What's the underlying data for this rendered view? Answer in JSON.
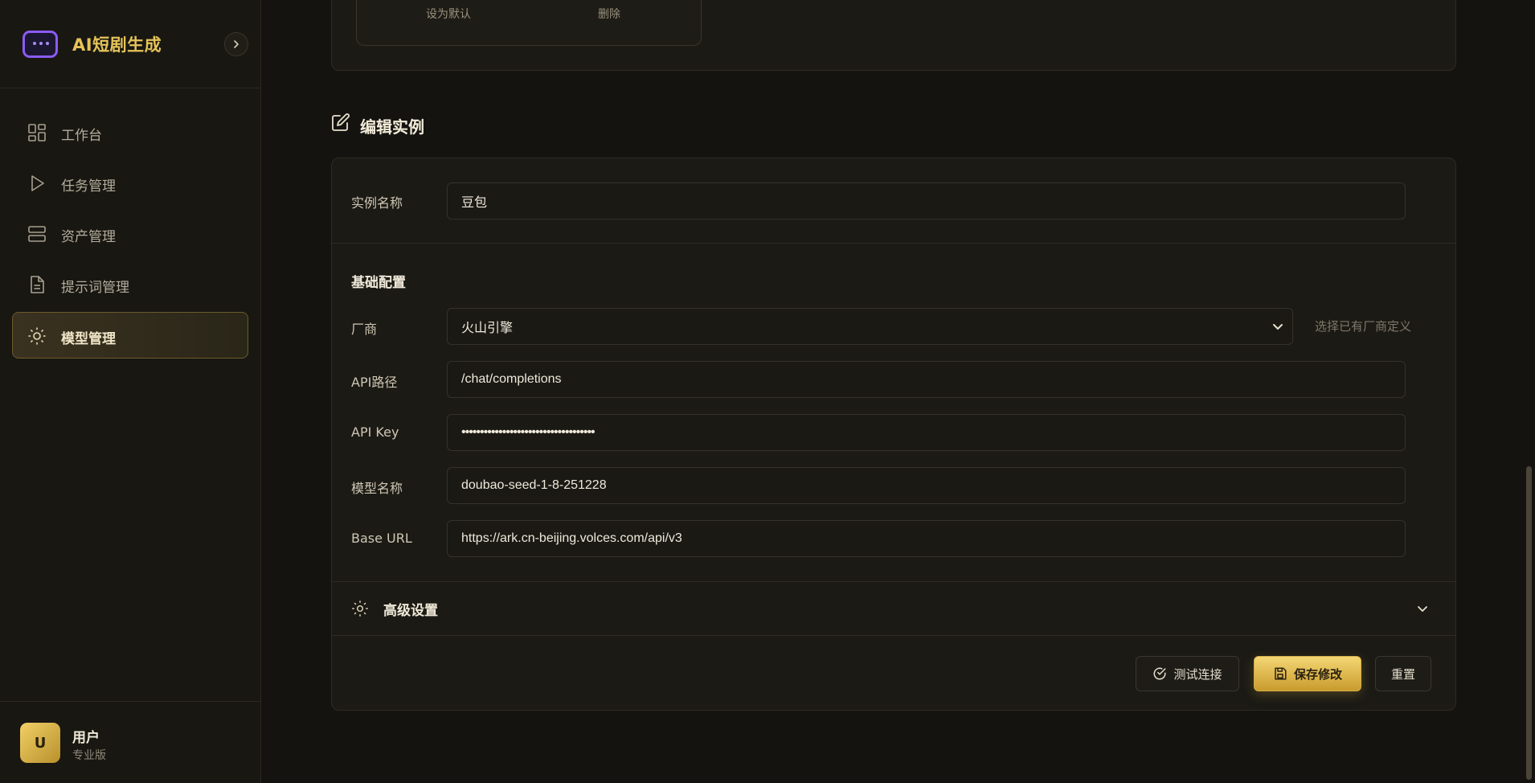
{
  "brand": {
    "title": "AI短剧生成",
    "logo_icon": "window-dots-icon",
    "collapse_icon": "chevron-right-icon"
  },
  "nav": {
    "items": [
      {
        "label": "工作台",
        "icon": "grid-icon",
        "active": false
      },
      {
        "label": "任务管理",
        "icon": "play-icon",
        "active": false
      },
      {
        "label": "资产管理",
        "icon": "server-icon",
        "active": false
      },
      {
        "label": "提示词管理",
        "icon": "file-text-icon",
        "active": false
      },
      {
        "label": "模型管理",
        "icon": "sun-icon",
        "active": true
      }
    ]
  },
  "user": {
    "avatar_letter": "U",
    "name": "用户",
    "plan": "专业版"
  },
  "top_card": {
    "set_default": "设为默认",
    "delete": "删除"
  },
  "edit": {
    "section_title": "编辑实例",
    "instance_name_label": "实例名称",
    "instance_name_value": "豆包",
    "basic_config": "基础配置",
    "vendor_label": "厂商",
    "vendor_value": "火山引擎",
    "vendor_hint": "选择已有厂商定义",
    "api_path_label": "API路径",
    "api_path_value": "/chat/completions",
    "api_key_label": "API Key",
    "api_key_value": "••••••••••••••••••••••••••••••••••••",
    "model_name_label": "模型名称",
    "model_name_value": "doubao-seed-1-8-251228",
    "base_url_label": "Base URL",
    "base_url_value": "https://ark.cn-beijing.volces.com/api/v3",
    "advanced_label": "高级设置"
  },
  "actions": {
    "test": "测试连接",
    "save": "保存修改",
    "reset": "重置"
  },
  "colors": {
    "accent_gold": "#e5c35a",
    "brand_purple": "#8b5cf6",
    "background": "#141310"
  }
}
